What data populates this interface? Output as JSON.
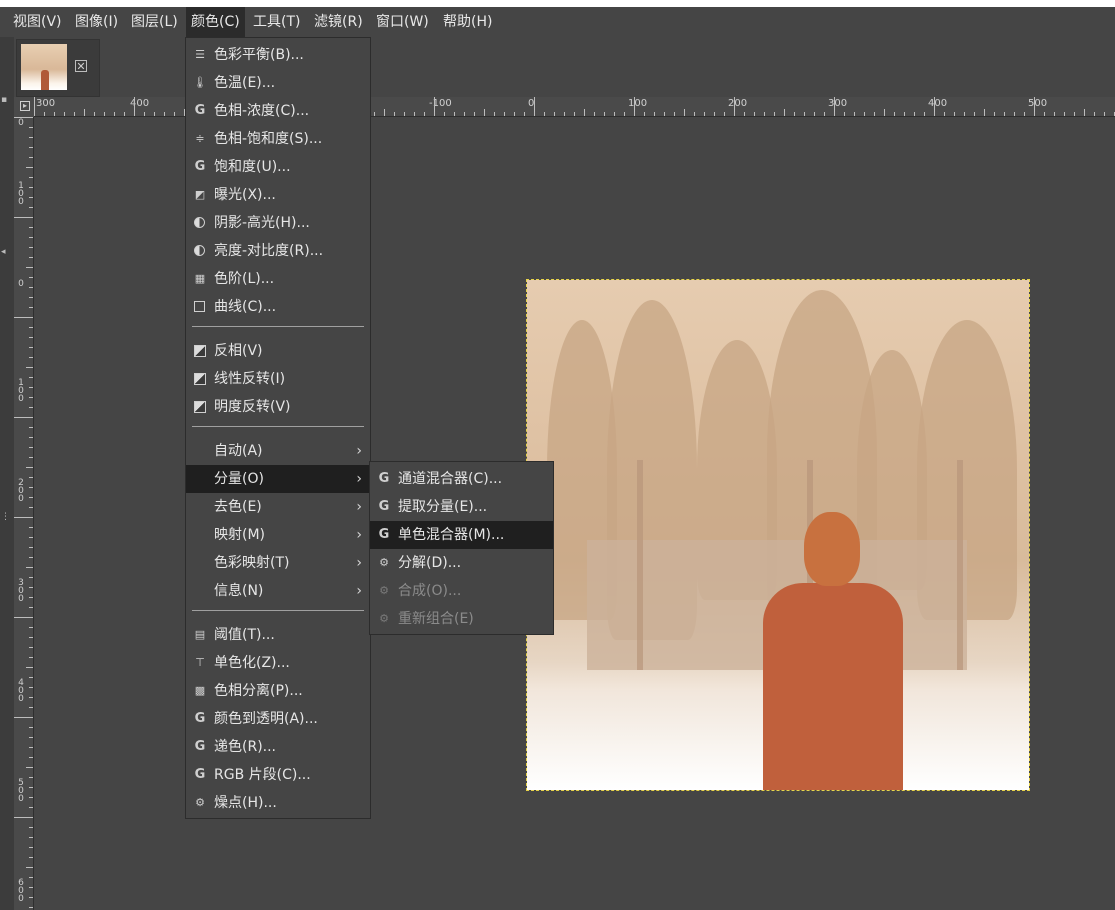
{
  "menubar": {
    "items": [
      {
        "label": "视图(V)"
      },
      {
        "label": "图像(I)"
      },
      {
        "label": "图层(L)"
      },
      {
        "label": "颜色(C)"
      },
      {
        "label": "工具(T)"
      },
      {
        "label": "滤镜(R)"
      },
      {
        "label": "窗口(W)"
      },
      {
        "label": "帮助(H)"
      }
    ],
    "active_index": 3
  },
  "image_tab": {
    "close_icon": "close-icon"
  },
  "ruler_top": {
    "labels": [
      "300",
      "400",
      "-100",
      "0",
      "100",
      "200",
      "300",
      "400",
      "500"
    ]
  },
  "ruler_left": {
    "labels": [
      "0",
      "100",
      "0",
      "100",
      "200",
      "300",
      "400",
      "500",
      "600"
    ]
  },
  "color_menu": {
    "items": [
      {
        "label": "色彩平衡(B)...",
        "icon": "color-balance-icon"
      },
      {
        "label": "色温(E)...",
        "icon": "thermometer-icon"
      },
      {
        "label": "色相-浓度(C)...",
        "icon": "gegl-icon"
      },
      {
        "label": "色相-饱和度(S)...",
        "icon": "hue-saturation-icon"
      },
      {
        "label": "饱和度(U)...",
        "icon": "gegl-icon"
      },
      {
        "label": "曝光(X)...",
        "icon": "exposure-icon"
      },
      {
        "label": "阴影-高光(H)...",
        "icon": "shadows-highlights-icon"
      },
      {
        "label": "亮度-对比度(R)...",
        "icon": "brightness-contrast-icon"
      },
      {
        "label": "色阶(L)...",
        "icon": "levels-icon"
      },
      {
        "label": "曲线(C)...",
        "icon": "curves-icon"
      },
      {
        "label": "反相(V)",
        "icon": "invert-icon"
      },
      {
        "label": "线性反转(I)",
        "icon": "invert-icon"
      },
      {
        "label": "明度反转(V)",
        "icon": "invert-icon"
      },
      {
        "label": "自动(A)",
        "submenu": true
      },
      {
        "label": "分量(O)",
        "submenu": true
      },
      {
        "label": "去色(E)",
        "submenu": true
      },
      {
        "label": "映射(M)",
        "submenu": true
      },
      {
        "label": "色彩映射(T)",
        "submenu": true
      },
      {
        "label": "信息(N)",
        "submenu": true
      },
      {
        "label": "阈值(T)...",
        "icon": "threshold-icon"
      },
      {
        "label": "单色化(Z)...",
        "icon": "colorize-icon"
      },
      {
        "label": "色相分离(P)...",
        "icon": "posterize-icon"
      },
      {
        "label": "颜色到透明(A)...",
        "icon": "gegl-icon"
      },
      {
        "label": "递色(R)...",
        "icon": "gegl-icon"
      },
      {
        "label": "RGB 片段(C)...",
        "icon": "gegl-icon"
      },
      {
        "label": "燥点(H)...",
        "icon": "plugin-icon"
      }
    ]
  },
  "components_submenu": {
    "items": [
      {
        "label": "通道混合器(C)...",
        "icon": "gegl-icon"
      },
      {
        "label": "提取分量(E)...",
        "icon": "gegl-icon"
      },
      {
        "label": "单色混合器(M)...",
        "icon": "gegl-icon"
      },
      {
        "label": "分解(D)...",
        "icon": "plugin-icon"
      },
      {
        "label": "合成(O)...",
        "icon": "plugin-icon",
        "disabled": true
      },
      {
        "label": "重新组合(E)",
        "icon": "plugin-icon",
        "disabled": true
      }
    ]
  },
  "colors": {
    "background": "#454545",
    "menu_highlight": "#1f1f1f",
    "selection_border": "#e8d44a",
    "coat": "#c0603c"
  }
}
